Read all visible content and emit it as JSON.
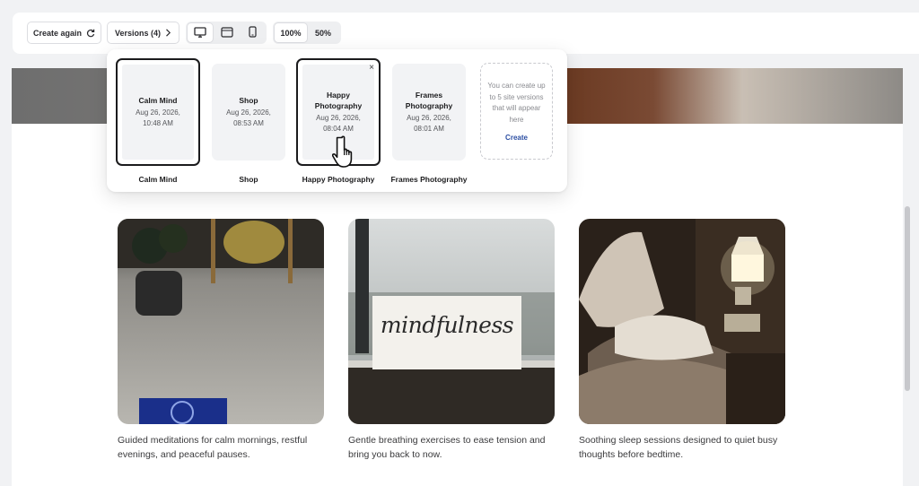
{
  "toolbar": {
    "create_again_label": "Create again",
    "versions_label": "Versions (4)",
    "devices": [
      {
        "icon": "desktop-icon",
        "active": true
      },
      {
        "icon": "tablet-icon",
        "active": false
      },
      {
        "icon": "mobile-icon",
        "active": false
      }
    ],
    "zoom_options": [
      "100%",
      "50%"
    ],
    "zoom_selected": "100%"
  },
  "versions_popover": {
    "versions": [
      {
        "name": "Calm Mind",
        "date": "Aug 26, 2026,",
        "time": "10:48 AM",
        "label": "Calm Mind",
        "selected": true
      },
      {
        "name": "Shop",
        "date": "Aug 26, 2026,",
        "time": "08:53 AM",
        "label": "Shop",
        "selected": false
      },
      {
        "name": "Happy Photography",
        "date": "Aug 26, 2026,",
        "time": "08:04 AM",
        "label": "Happy Photography",
        "selected": true,
        "hovered": true
      },
      {
        "name": "Frames Photography",
        "date": "Aug 26, 2026,",
        "time": "08:01 AM",
        "label": "Frames Photography",
        "selected": false
      }
    ],
    "placeholder": {
      "text": "You can create up to 5 site versions that will appear here",
      "link": "Create"
    },
    "close_symbol": "×"
  },
  "page": {
    "cards": [
      {
        "image": "meditation-room-image",
        "caption": "Guided meditations for calm mornings, restful evenings, and peaceful pauses."
      },
      {
        "image": "mindfulness-sign-image",
        "sign_text": "mindfulness",
        "caption": "Gentle breathing exercises to ease tension and bring you back to now."
      },
      {
        "image": "bedroom-lamp-image",
        "caption": "Soothing sleep sessions designed to quiet busy thoughts before bedtime."
      }
    ]
  },
  "colors": {
    "accent_link": "#2b4ea2",
    "selected_border": "#1b1b1d",
    "app_background": "#f1f2f4"
  }
}
